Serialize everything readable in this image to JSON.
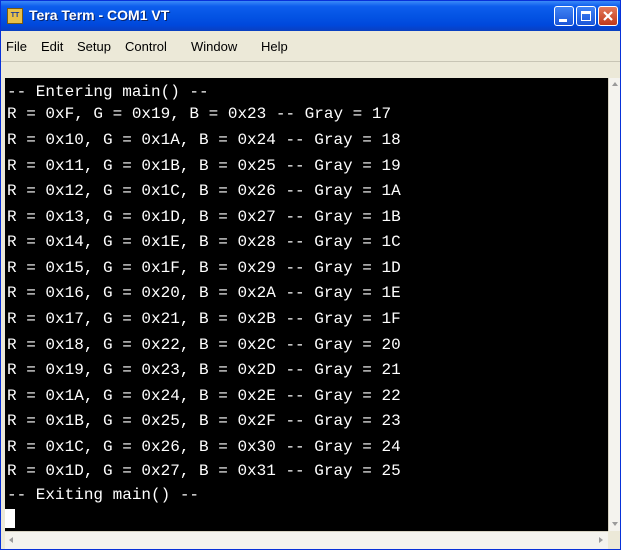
{
  "window": {
    "title": "Tera Term - COM1 VT",
    "icon": "teraterm-app-icon",
    "icon_text": "TT"
  },
  "menubar": {
    "items": [
      "File",
      "Edit",
      "Setup",
      "Control",
      "Window",
      "Help"
    ]
  },
  "terminal": {
    "lines": [
      "-- Entering main() --",
      "R = 0xF, G = 0x19, B = 0x23 -- Gray = 17",
      "R = 0x10, G = 0x1A, B = 0x24 -- Gray = 18",
      "R = 0x11, G = 0x1B, B = 0x25 -- Gray = 19",
      "R = 0x12, G = 0x1C, B = 0x26 -- Gray = 1A",
      "R = 0x13, G = 0x1D, B = 0x27 -- Gray = 1B",
      "R = 0x14, G = 0x1E, B = 0x28 -- Gray = 1C",
      "R = 0x15, G = 0x1F, B = 0x29 -- Gray = 1D",
      "R = 0x16, G = 0x20, B = 0x2A -- Gray = 1E",
      "R = 0x17, G = 0x21, B = 0x2B -- Gray = 1F",
      "R = 0x18, G = 0x22, B = 0x2C -- Gray = 20",
      "R = 0x19, G = 0x23, B = 0x2D -- Gray = 21",
      "R = 0x1A, G = 0x24, B = 0x2E -- Gray = 22",
      "R = 0x1B, G = 0x25, B = 0x2F -- Gray = 23",
      "R = 0x1C, G = 0x26, B = 0x30 -- Gray = 24",
      "R = 0x1D, G = 0x27, B = 0x31 -- Gray = 25",
      "-- Exiting main() --"
    ]
  },
  "colors": {
    "titlebar": "#0454e4",
    "terminal_bg": "#000000",
    "terminal_fg": "#ffffff",
    "close_button": "#c0391a"
  }
}
